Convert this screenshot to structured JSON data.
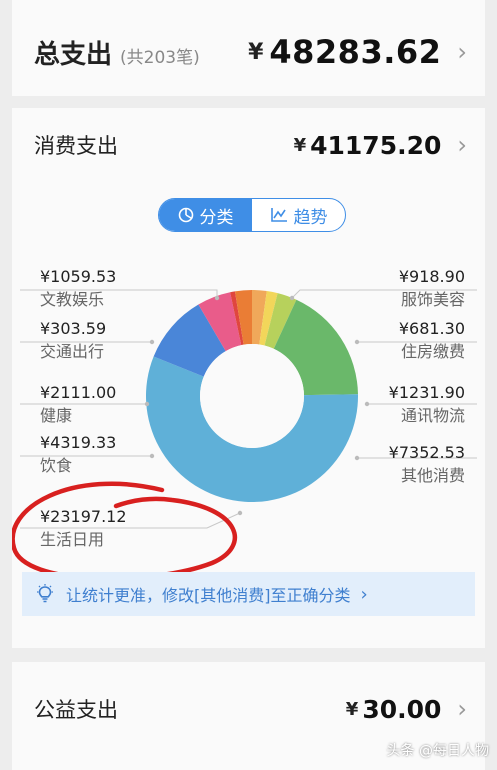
{
  "summary": {
    "title": "总支出",
    "count": "(共203笔)",
    "currency": "¥",
    "amount": "48283.62",
    "chevron": "›"
  },
  "consume": {
    "title": "消费支出",
    "currency": "¥",
    "amount": "41175.20",
    "chevron": "›"
  },
  "toggle": {
    "active_label": "分类",
    "inactive_label": "趋势",
    "active_icon": "pie-chart-icon",
    "inactive_icon": "line-trend-icon",
    "accent": "#3f8ee6"
  },
  "chart_data": {
    "type": "pie",
    "categories": [
      "服饰美容",
      "住房缴费",
      "通讯物流",
      "其他消费",
      "生活日用",
      "饮食",
      "健康",
      "交通出行",
      "文教娱乐"
    ],
    "values": [
      918.9,
      681.3,
      1231.9,
      7352.53,
      23197.12,
      4319.33,
      2111.0,
      303.59,
      1059.53
    ],
    "labels": [
      "¥918.90",
      "¥681.30",
      "¥1231.90",
      "¥7352.53",
      "¥23197.12",
      "¥4319.33",
      "¥2111.00",
      "¥303.59",
      "¥1059.53"
    ],
    "colors": [
      "#f0a85a",
      "#f2d65a",
      "#b7d15c",
      "#6ab86a",
      "#5fb0d8",
      "#4a86d8",
      "#e95c8a",
      "#e0463e",
      "#ea7d35"
    ],
    "legend": "around"
  },
  "tip": {
    "icon": "lightbulb-icon",
    "text": "让统计更准，修改[其他消费]至正确分类",
    "chevron": "›"
  },
  "welfare": {
    "title": "公益支出",
    "currency": "¥",
    "amount": "30.00",
    "chevron": "›"
  },
  "watermark": "头条 @每日人物"
}
